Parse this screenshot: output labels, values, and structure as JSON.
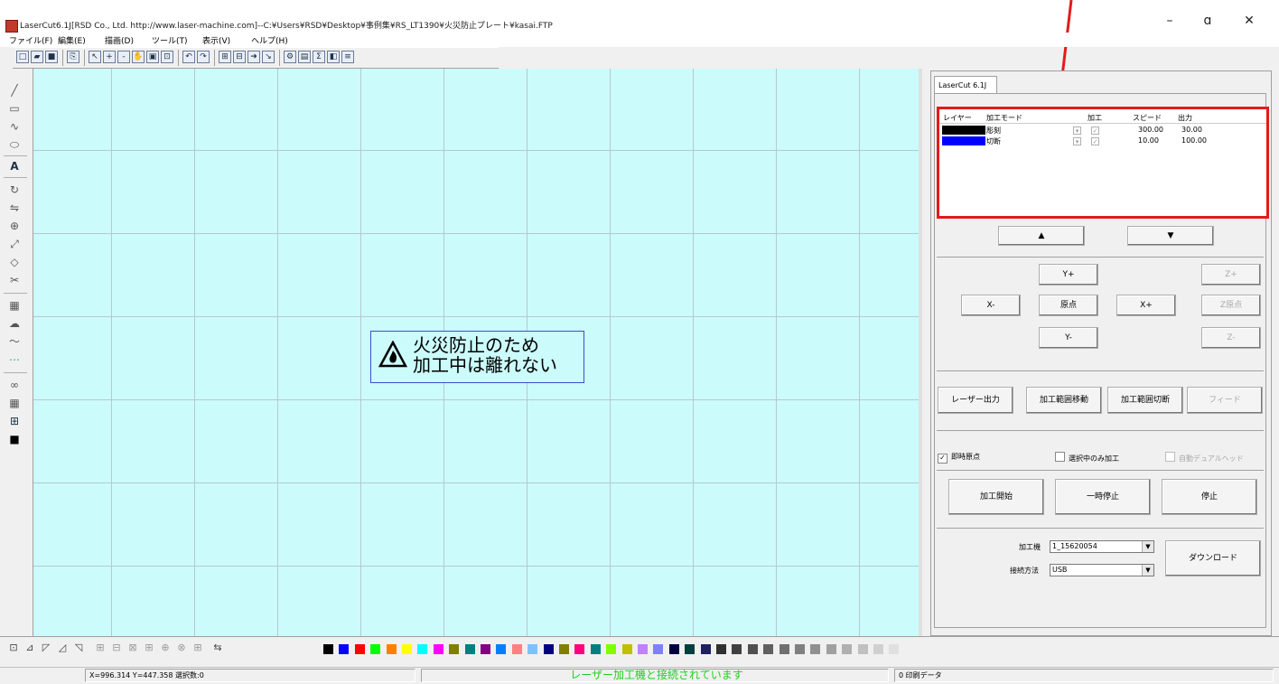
{
  "window": {
    "title": "LaserCut6.1J[RSD Co., Ltd. http://www.laser-machine.com]--C:¥Users¥RSD¥Desktop¥事例集¥RS_LT1390¥火災防止プレート¥kasai.FTP",
    "minimize": "–",
    "maximize": "ɑ",
    "close": "✕"
  },
  "menu": [
    "ファイル(F)",
    "編集(E)",
    "描画(D)",
    "ツール(T)",
    "表示(V)",
    "ヘルプ(H)"
  ],
  "toolbar_icons": [
    "new-icon",
    "open-icon",
    "save-icon",
    "import-icon",
    "select-icon",
    "zoom-in-icon",
    "zoom-out-icon",
    "pan-icon",
    "zoom-fit-icon",
    "zoom-window-icon",
    "undo-icon",
    "redo-icon",
    "align-icon",
    "group-icon",
    "arrow-icon",
    "line-icon",
    "settings-icon",
    "display-icon",
    "sum-icon",
    "preview-icon",
    "params-icon"
  ],
  "left_tool_icons": [
    "line-tool-icon",
    "rect-tool-icon",
    "curve-tool-icon",
    "ellipse-tool-icon",
    "text-tool-icon",
    "rotate-icon",
    "mirror-icon",
    "array-icon",
    "scale-icon",
    "node-icon",
    "cut-icon",
    "fill-icon",
    "offset-icon",
    "smooth-icon",
    "dotted-icon",
    "combine-icon",
    "grid-icon",
    "array-copy-icon",
    "color-icon"
  ],
  "canvas": {
    "sign_line1": "火災防止のため",
    "sign_line2": "加工中は離れない"
  },
  "panel": {
    "tab": "LaserCut 6.1J",
    "layer_headers": [
      "レイヤー",
      "加工モード",
      "加工",
      "スピード",
      "出力"
    ],
    "layers": [
      {
        "color": "#000000",
        "mode": "彫刻",
        "speed": "300.00",
        "power": "30.00"
      },
      {
        "color": "#0000ff",
        "mode": "切断",
        "speed": "10.00",
        "power": "100.00"
      }
    ],
    "up": "▲",
    "down": "▼",
    "yplus": "Y+",
    "xminus": "X-",
    "origin": "原点",
    "xplus": "X+",
    "yminus": "Y-",
    "zplus": "Z+",
    "zorigin": "Z原点",
    "zminus": "Z-",
    "laser_output": "レーザー出力",
    "range_move": "加工範囲移動",
    "range_cut": "加工範囲切断",
    "feed": "フィード",
    "chk_instant_origin": "即時原点",
    "chk_selected_only": "選択中のみ加工",
    "chk_auto_dual": "自動デュアルヘッド",
    "start": "加工開始",
    "pause": "一時停止",
    "stop": "停止",
    "machine_label": "加工機",
    "machine_value": "1_15620054",
    "connect_label": "接続方法",
    "connect_value": "USB",
    "download": "ダウンロード"
  },
  "palette": [
    "#000000",
    "#0000ff",
    "#ff0000",
    "#00ff00",
    "#ff8000",
    "#ffff00",
    "#00ffff",
    "#ff00ff",
    "#808000",
    "#008080",
    "#800080",
    "#0080ff",
    "#ff8080",
    "#80c0ff",
    "#000080",
    "#808000",
    "#ff0080",
    "#008080",
    "#80ff00",
    "#c0c000",
    "#c080ff",
    "#8080ff",
    "#000040",
    "#004040",
    "#202060",
    "#303030",
    "#404040",
    "#505050",
    "#606060",
    "#707070",
    "#808080",
    "#909090",
    "#a0a0a0",
    "#b0b0b0",
    "#c0c0c0",
    "#d0d0d0",
    "#e0e0e0",
    "#f0f0f0"
  ],
  "status": {
    "coords": "X=996.314 Y=447.358 選択数:0",
    "connection": "レーザー加工機と接続されています",
    "print_data": "0 印刷データ"
  }
}
